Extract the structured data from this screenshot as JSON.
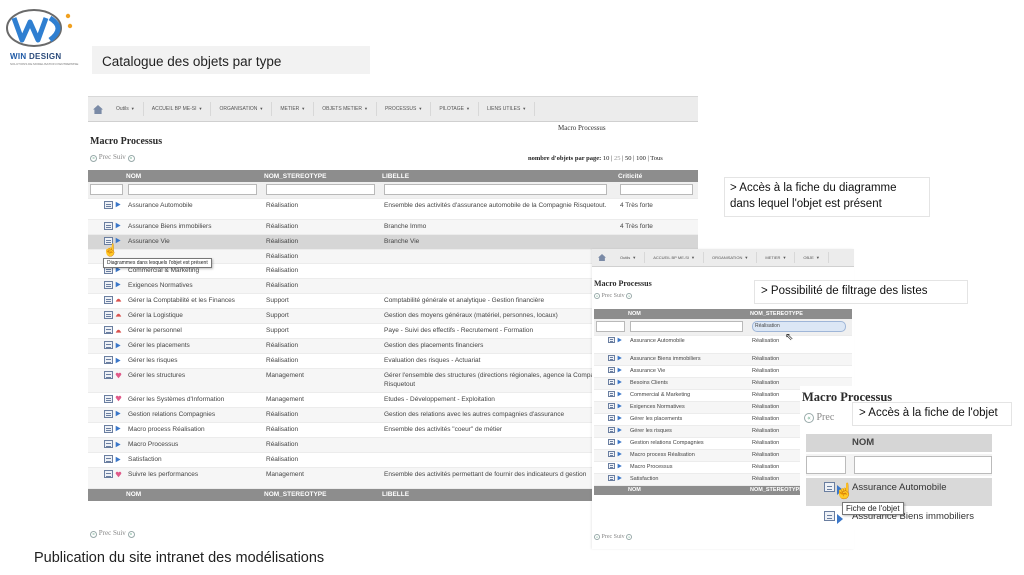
{
  "logo": {
    "brand_win": "WIN",
    "brand_design": " DESIGN",
    "tagline": "SOLUTIONS DE MODELISATION D'ENTREPRISE"
  },
  "slide": {
    "title": "Catalogue des objets par type",
    "footer": "Publication du site intranet des modélisations"
  },
  "colors": {
    "header": "#8d8d8d",
    "nav": "#ececec",
    "obj_blue": "#3b77c9",
    "obj_red": "#d9534f",
    "obj_pink": "#e05b8a"
  },
  "nav": [
    "Outils",
    "ACCUEIL BP ME-SI",
    "ORGANISATION",
    "METIER",
    "OBJETS METIER",
    "PROCESSUS",
    "PILOTAGE",
    "LIENS UTILES"
  ],
  "nav_short": [
    "Outils",
    "ACCUEIL BP ME-SI",
    "ORGANISATION",
    "METIER",
    "OBJE"
  ],
  "main": {
    "breadcrumb": "Macro Processus",
    "title": "Macro Processus",
    "prev": "Prec",
    "next": "Suiv",
    "per_page_label": "nombre d'objets par page:",
    "per_page": [
      "10",
      "25",
      "50",
      "100",
      "Tous"
    ],
    "columns": [
      "NOM",
      "NOM_STEREOTYPE",
      "LIBELLE",
      "Criticité"
    ],
    "tooltip": "Diagrammes dans lesquels l'objet est présent",
    "rows": [
      {
        "nom": "Assurance Automobile",
        "stereo": "Réalisation",
        "libelle": "Ensemble des activités d'assurance automobile de la Compagnie Risquetout.",
        "crit": "4 Très forte",
        "kind": "blue"
      },
      {
        "nom": "Assurance Biens immobiliers",
        "stereo": "Réalisation",
        "libelle": "Branche Immo",
        "crit": "4 Très forte",
        "kind": "blue"
      },
      {
        "nom": "Assurance Vie",
        "stereo": "Réalisation",
        "libelle": "Branche Vie",
        "crit": "",
        "kind": "blue"
      },
      {
        "nom": "",
        "stereo": "Réalisation",
        "libelle": "",
        "crit": "",
        "kind": "none"
      },
      {
        "nom": "Commercial & Marketing",
        "stereo": "Réalisation",
        "libelle": "",
        "crit": "",
        "kind": "blue"
      },
      {
        "nom": "Exigences Normatives",
        "stereo": "Réalisation",
        "libelle": "",
        "crit": "",
        "kind": "blue"
      },
      {
        "nom": "Gérer la Comptabilité et les Finances",
        "stereo": "Support",
        "libelle": "Comptabilité générale et analytique - Gestion financière",
        "crit": "",
        "kind": "red"
      },
      {
        "nom": "Gérer la Logistique",
        "stereo": "Support",
        "libelle": "Gestion des moyens généraux (matériel, personnes, locaux)",
        "crit": "",
        "kind": "red"
      },
      {
        "nom": "Gérer le personnel",
        "stereo": "Support",
        "libelle": "Paye - Suivi des effectifs - Recrutement - Formation",
        "crit": "",
        "kind": "red"
      },
      {
        "nom": "Gérer les placements",
        "stereo": "Réalisation",
        "libelle": "Gestion des placements financiers",
        "crit": "",
        "kind": "blue"
      },
      {
        "nom": "Gérer les risques",
        "stereo": "Réalisation",
        "libelle": "Evaluation des risques - Actuariat",
        "crit": "",
        "kind": "blue"
      },
      {
        "nom": "Gérer les structures",
        "stereo": "Management",
        "libelle": "Gérer l'ensemble des structures (directions régionales, agence la Compagnie Risquetout",
        "crit": "",
        "kind": "pink"
      },
      {
        "nom": "Gérer les Systèmes d'Information",
        "stereo": "Management",
        "libelle": "Etudes - Développement - Exploitation",
        "crit": "",
        "kind": "pink"
      },
      {
        "nom": "Gestion relations Compagnies",
        "stereo": "Réalisation",
        "libelle": "Gestion des relations avec les autres compagnies d'assurance",
        "crit": "",
        "kind": "blue"
      },
      {
        "nom": "Macro process Réalisation",
        "stereo": "Réalisation",
        "libelle": "Ensemble des activités \"coeur\" de métier",
        "crit": "",
        "kind": "blue"
      },
      {
        "nom": "Macro Processus",
        "stereo": "Réalisation",
        "libelle": "",
        "crit": "",
        "kind": "blue"
      },
      {
        "nom": "Satisfaction",
        "stereo": "Réalisation",
        "libelle": "",
        "crit": "",
        "kind": "blue"
      },
      {
        "nom": "Suivre les performances",
        "stereo": "Management",
        "libelle": "Ensemble des activités permettant de fournir des indicateurs d gestion",
        "crit": "",
        "kind": "pink"
      }
    ]
  },
  "filter_panel": {
    "title": "Macro Processus",
    "prev": "Prec",
    "next": "Suiv",
    "columns": [
      "NOM",
      "NOM_STEREOTYPE"
    ],
    "filter_value": "Réalisation",
    "rows": [
      {
        "nom": "Assurance Automobile",
        "stereo": "Réalisation"
      },
      {
        "nom": "Assurance Biens immobiliers",
        "stereo": "Réalisation"
      },
      {
        "nom": "Assurance Vie",
        "stereo": "Réalisation"
      },
      {
        "nom": "Besoins Clients",
        "stereo": "Réalisation"
      },
      {
        "nom": "Commercial & Marketing",
        "stereo": "Réalisation"
      },
      {
        "nom": "Exigences Normatives",
        "stereo": "Réalisation"
      },
      {
        "nom": "Gérer les placements",
        "stereo": "Réalisation"
      },
      {
        "nom": "Gérer les risques",
        "stereo": "Réalisation"
      },
      {
        "nom": "Gestion relations Compagnies",
        "stereo": "Réalisation"
      },
      {
        "nom": "Macro process Réalisation",
        "stereo": "Réalisation"
      },
      {
        "nom": "Macro Processus",
        "stereo": "Réalisation"
      },
      {
        "nom": "Satisfaction",
        "stereo": "Réalisation"
      }
    ]
  },
  "zoom_panel": {
    "title": "Macro Processus",
    "prev": "Prec",
    "column": "NOM",
    "rows": [
      "Assurance Automobile",
      "Assurance Biens immobiliers"
    ],
    "tooltip": "Fiche de l'objet"
  },
  "annotations": {
    "diagram": "> Accès à la fiche du diagramme dans lequel l'objet est présent",
    "filter": "> Possibilité de filtrage des listes",
    "object": "> Accès à la fiche de l'objet"
  }
}
